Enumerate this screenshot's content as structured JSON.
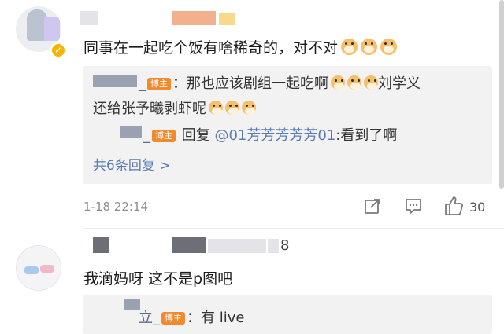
{
  "comments": [
    {
      "text": "同事在一起吃个饭有啥稀奇的，对不对",
      "emoji_count": 3,
      "replies": [
        {
          "user_suffix": "_",
          "badge": "博主",
          "text_line1": "：那也应该剧组一起吃啊",
          "text_line1_tail": "刘学义",
          "text_line2": "还给张予曦剥虾呢"
        },
        {
          "user_suffix": "_",
          "badge": "博主",
          "prefix": "回复",
          "mention": "@01芳芳芳芳芳01",
          "text": ":看到了啊"
        }
      ],
      "more_replies": "共6条回复 >",
      "timestamp": "1-18 22:14",
      "likes": "30"
    },
    {
      "name_tail": "8",
      "text": "我滴妈呀 这不是p图吧",
      "replies": [
        {
          "user_partial": "_",
          "user_before": "立",
          "badge": "博主",
          "text": "：有 live"
        }
      ]
    }
  ],
  "icons": {
    "verified": "verified-badge-icon",
    "share": "share-icon",
    "comment": "comment-icon",
    "like": "thumbs-up-icon",
    "emoji": "doge-emoji"
  }
}
